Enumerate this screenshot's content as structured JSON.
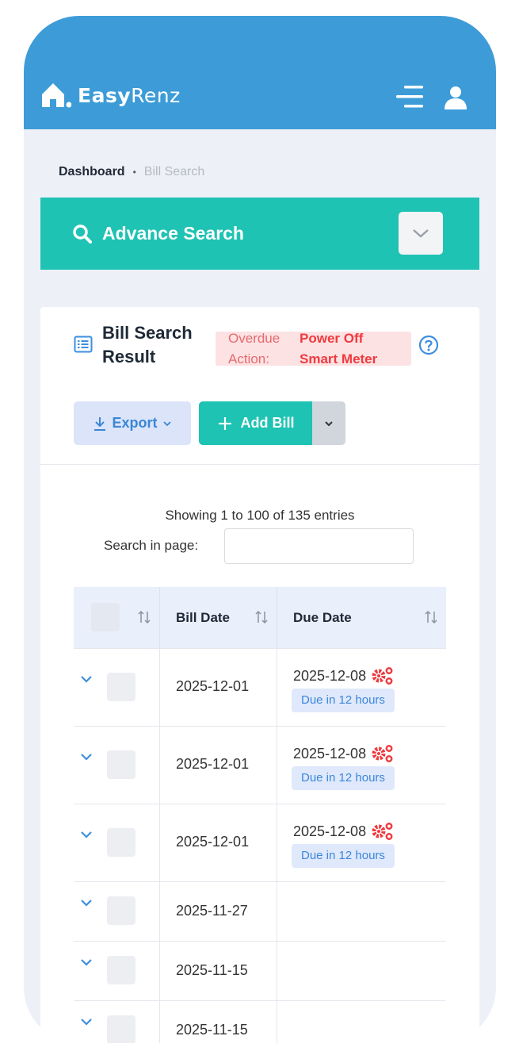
{
  "header": {
    "brand_bold": "Easy",
    "brand_light": "Renz"
  },
  "breadcrumb": {
    "home": "Dashboard",
    "separator": "•",
    "current": "Bill Search"
  },
  "advanced_search": {
    "label": "Advance Search"
  },
  "result_card": {
    "title": "Bill Search Result",
    "overdue": {
      "label_line1": "Overdue",
      "label_line2": "Action:",
      "value_line1": "Power Off",
      "value_line2": "Smart Meter"
    },
    "export_label": "Export",
    "add_bill_label": "Add Bill",
    "showing": "Showing 1 to 100 of 135 entries",
    "search_label": "Search in page:",
    "search_value": ""
  },
  "table": {
    "columns": [
      "",
      "Bill Date",
      "Due Date"
    ],
    "rows": [
      {
        "bill_date": "2025-12-01",
        "due_date": "2025-12-08",
        "badge": "Due in 12 hours"
      },
      {
        "bill_date": "2025-12-01",
        "due_date": "2025-12-08",
        "badge": "Due in 12 hours"
      },
      {
        "bill_date": "2025-12-01",
        "due_date": "2025-12-08",
        "badge": "Due in 12 hours"
      },
      {
        "bill_date": "2025-11-27",
        "due_date": "",
        "badge": ""
      },
      {
        "bill_date": "2025-11-15",
        "due_date": "",
        "badge": ""
      },
      {
        "bill_date": "2025-11-15",
        "due_date": "",
        "badge": ""
      }
    ]
  },
  "colors": {
    "header_blue": "#3d9cd8",
    "teal": "#1fc3b3",
    "overdue_red": "#ef3a3f",
    "badge_blue": "#3d86dc"
  },
  "icons": {
    "logo": "house-icon",
    "menu": "menu-icon",
    "user": "user-icon",
    "search": "search-icon",
    "toggle": "chevron-down-icon",
    "title": "list-icon",
    "help": "help-icon",
    "export": "download-icon",
    "add": "plus-icon",
    "sort": "sort-icon",
    "expand": "chevron-down-icon",
    "due_alert": "gears-icon"
  }
}
